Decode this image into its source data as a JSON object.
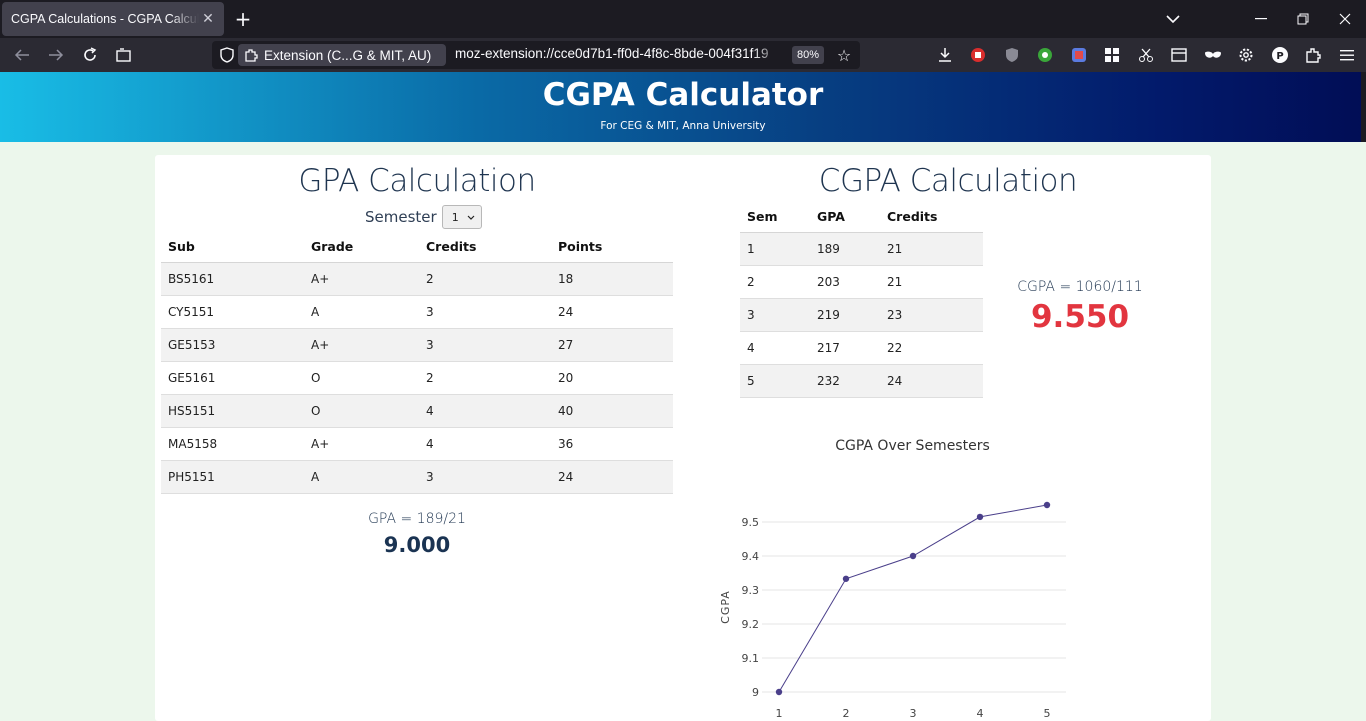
{
  "browser": {
    "tab_title": "CGPA Calculations - CGPA Calculator",
    "extension_chip": "Extension (C...G & MIT, AU)",
    "url": "moz-extension://cce0d7b1-ff0d-4f8c-8bde-004f31f19",
    "zoom": "80%"
  },
  "header": {
    "title": "CGPA Calculator",
    "subtitle": "For CEG & MIT, Anna University"
  },
  "gpa": {
    "heading": "GPA Calculation",
    "semester_label": "Semester",
    "semester_value": "1",
    "columns": [
      "Sub",
      "Grade",
      "Credits",
      "Points"
    ],
    "rows": [
      [
        "BS5161",
        "A+",
        "2",
        "18"
      ],
      [
        "CY5151",
        "A",
        "3",
        "24"
      ],
      [
        "GE5153",
        "A+",
        "3",
        "27"
      ],
      [
        "GE5161",
        "O",
        "2",
        "20"
      ],
      [
        "HS5151",
        "O",
        "4",
        "40"
      ],
      [
        "MA5158",
        "A+",
        "4",
        "36"
      ],
      [
        "PH5151",
        "A",
        "3",
        "24"
      ]
    ],
    "fraction": "GPA = 189/21",
    "value": "9.000"
  },
  "cgpa": {
    "heading": "CGPA Calculation",
    "columns": [
      "Sem",
      "GPA",
      "Credits"
    ],
    "rows": [
      [
        "1",
        "189",
        "21"
      ],
      [
        "2",
        "203",
        "21"
      ],
      [
        "3",
        "219",
        "23"
      ],
      [
        "4",
        "217",
        "22"
      ],
      [
        "5",
        "232",
        "24"
      ]
    ],
    "fraction": "CGPA = 1060/111",
    "value": "9.550"
  },
  "chart_data": {
    "type": "line",
    "title": "CGPA Over Semesters",
    "xlabel": "",
    "ylabel": "CGPA",
    "x": [
      1,
      2,
      3,
      4,
      5
    ],
    "values": [
      9.0,
      9.333,
      9.4,
      9.515,
      9.55
    ],
    "ylim": [
      9.0,
      9.5
    ],
    "yticks": [
      9,
      9.1,
      9.2,
      9.3,
      9.4,
      9.5
    ],
    "grid": true,
    "color": "#4a3f8a"
  }
}
